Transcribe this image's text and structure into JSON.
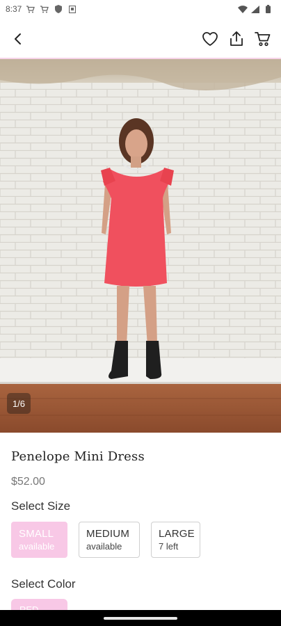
{
  "status_bar": {
    "time": "8:37",
    "left_icons": [
      "cart-icon",
      "cart-icon",
      "shield-icon",
      "square-icon"
    ],
    "right_icons": [
      "wifi-icon",
      "signal-icon",
      "battery-icon"
    ]
  },
  "app_bar": {
    "back_icon": "back-arrow-icon",
    "actions": [
      "heart-icon",
      "share-icon",
      "cart-icon"
    ]
  },
  "gallery": {
    "counter": "1/6",
    "current": 1,
    "total": 6
  },
  "product": {
    "title": "Penelope Mini Dress",
    "price": "$52.00"
  },
  "size": {
    "label": "Select Size",
    "options": [
      {
        "name": "SMALL",
        "availability": "available",
        "selected": true
      },
      {
        "name": "MEDIUM",
        "availability": "available",
        "selected": false
      },
      {
        "name": "LARGE",
        "availability": "7 left",
        "selected": false
      }
    ]
  },
  "color": {
    "label": "Select Color",
    "selected_chip": "RED"
  },
  "colors": {
    "accent_pink": "#f8c8e6",
    "dress_red": "#f0505e",
    "app_bar_divider": "#f7d3e8"
  }
}
